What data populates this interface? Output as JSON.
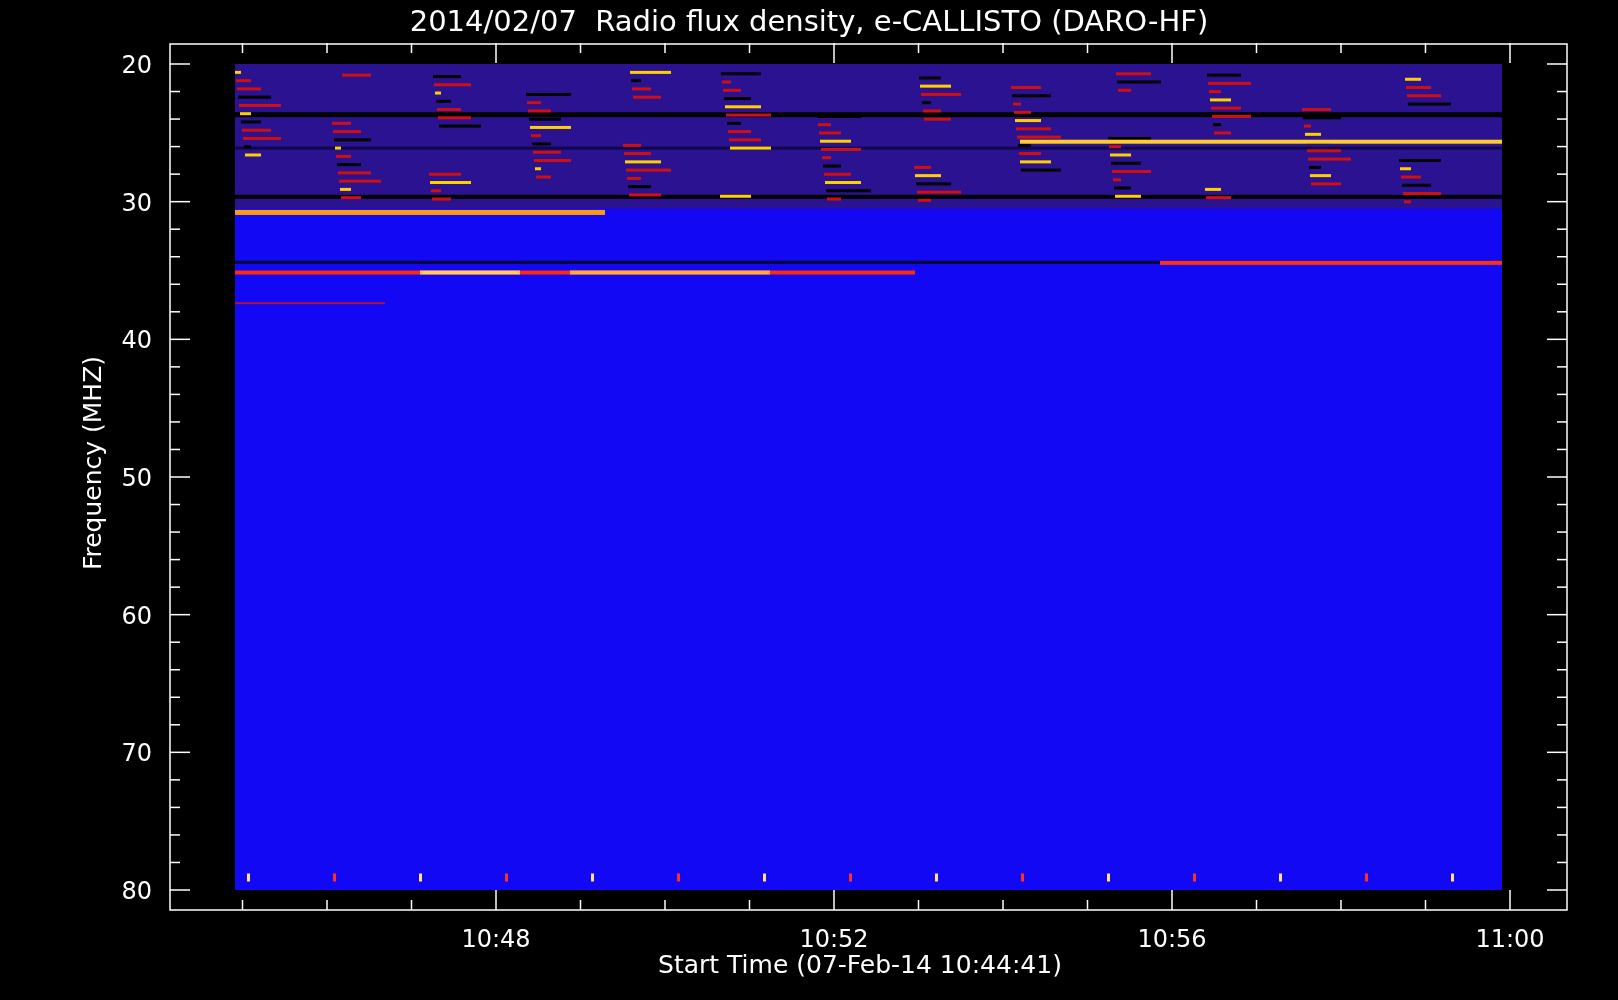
{
  "title": "2014/02/07  Radio flux density, e-CALLISTO (DARO-HF)",
  "ylabel": "Frequency (MHZ)",
  "xlabel": "Start Time (07-Feb-14 10:44:41)",
  "yticks": [
    "20",
    "30",
    "40",
    "50",
    "60",
    "70",
    "80"
  ],
  "xticks": [
    "10:48",
    "10:52",
    "10:56",
    "11:00"
  ]
}
